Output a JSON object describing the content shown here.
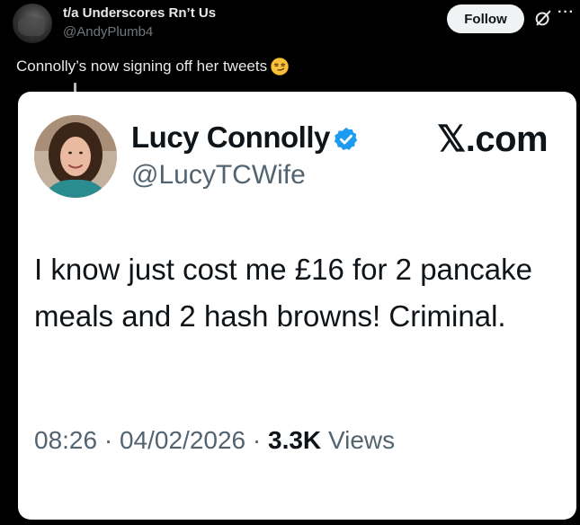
{
  "post": {
    "author_name": "t/a Underscores Rn’t Us",
    "author_handle": "@AndyPlumb4",
    "follow_label": "Follow",
    "more_label": "···",
    "text": "Connolly’s now signing off her tweets"
  },
  "quoted_card": {
    "name": "Lucy Connolly",
    "handle": "@LucyTCWife",
    "site_label": "𝕏.com",
    "text": "I know just cost me £16 for 2 pancake meals and 2 hash browns! Criminal.",
    "time": "08:26",
    "separator": "·",
    "date": "04/02/2026",
    "views_count": "3.3K",
    "views_label": "Views",
    "verified_color": "#1d9bf0"
  },
  "icons": {
    "grok": "grok-icon",
    "more": "more-icon",
    "emoji": "smirking-face-icon",
    "verified": "verified-badge-icon"
  }
}
